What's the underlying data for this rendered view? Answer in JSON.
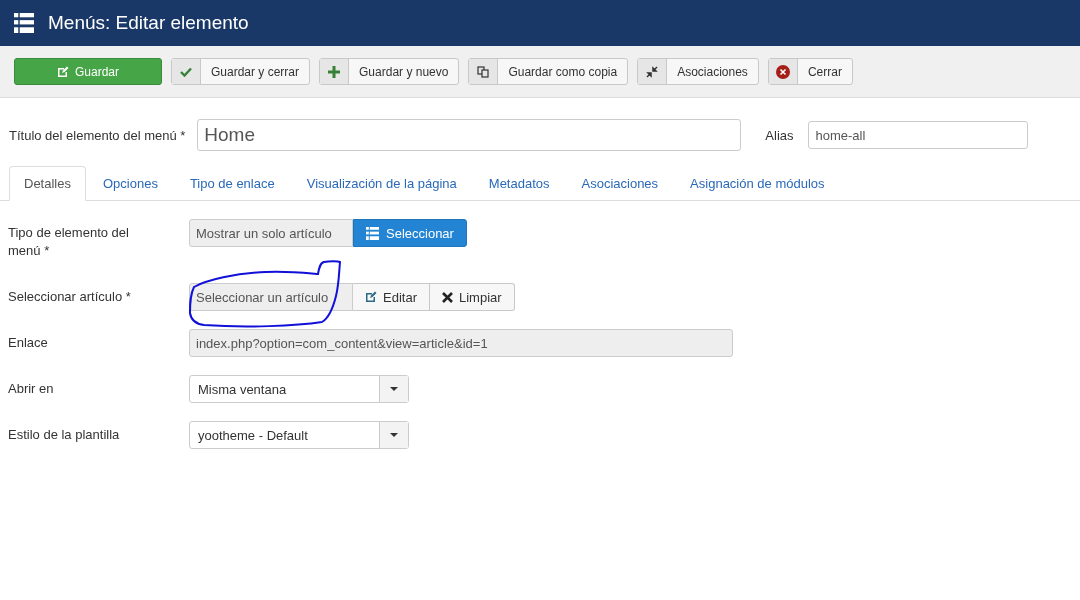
{
  "header": {
    "title": "Menús: Editar elemento"
  },
  "toolbar": [
    {
      "label": "Guardar",
      "kind": "primary"
    },
    {
      "label": "Guardar y cerrar",
      "kind": "addon"
    },
    {
      "label": "Guardar y nuevo",
      "kind": "addon"
    },
    {
      "label": "Guardar como copia",
      "kind": "addon"
    },
    {
      "label": "Asociaciones",
      "kind": "addon"
    },
    {
      "label": "Cerrar",
      "kind": "addon"
    }
  ],
  "title_field": {
    "label": "Título del elemento del menú *",
    "value": "Home"
  },
  "alias_field": {
    "label": "Alias",
    "value": "home-all"
  },
  "tabs": [
    {
      "label": "Detalles",
      "selected": true
    },
    {
      "label": "Opciones",
      "selected": false
    },
    {
      "label": "Tipo de enlace",
      "selected": false
    },
    {
      "label": "Visualización de la página",
      "selected": false
    },
    {
      "label": "Metadatos",
      "selected": false
    },
    {
      "label": "Asociaciones",
      "selected": false
    },
    {
      "label": "Asignación de módulos",
      "selected": false
    }
  ],
  "fields": [
    {
      "kind": "picker",
      "label": "Tipo de elemento del menú *",
      "value": "Mostrar un solo artículo",
      "buttons": [
        "Seleccionar"
      ]
    },
    {
      "kind": "modal",
      "label": "Seleccionar artículo *",
      "value": "Seleccionar un artículo",
      "buttons": [
        "Editar",
        "Limpiar"
      ]
    },
    {
      "kind": "readonly",
      "label": "Enlace",
      "value": "index.php?option=com_content&view=article&id=1"
    },
    {
      "kind": "select",
      "label": "Abrir en",
      "value": "Misma ventana"
    },
    {
      "kind": "select",
      "label": "Estilo de la plantilla",
      "value": "yootheme - Default"
    }
  ]
}
